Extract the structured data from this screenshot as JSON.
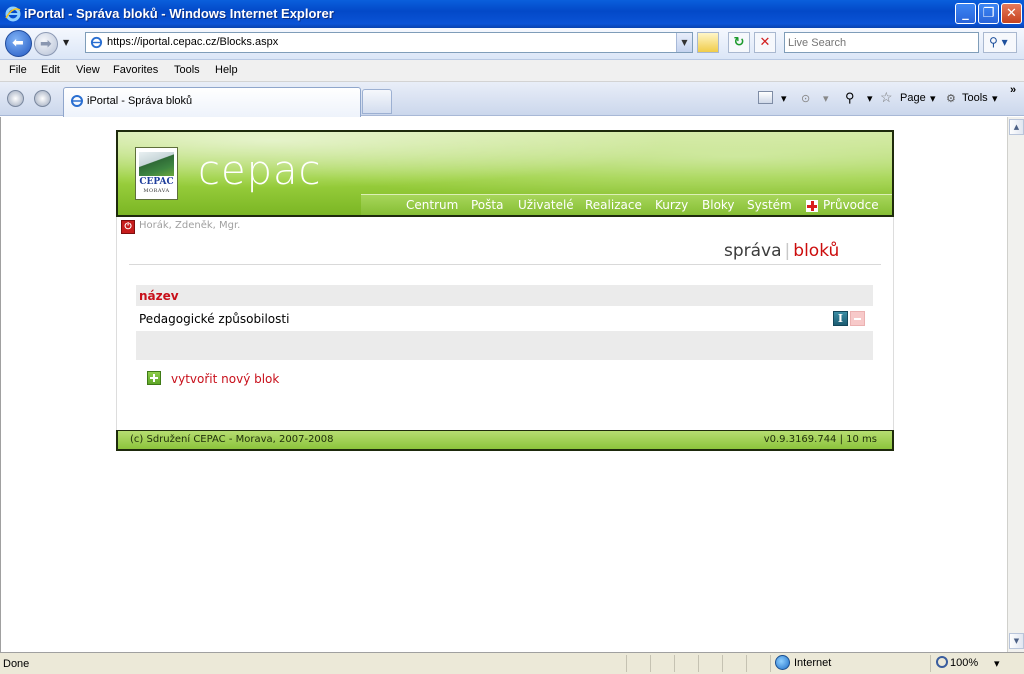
{
  "window": {
    "title": "iPortal - Správa bloků - Windows Internet Explorer"
  },
  "address": {
    "url": "https://iportal.cepac.cz/Blocks.aspx"
  },
  "search": {
    "placeholder": "Live Search"
  },
  "menu": {
    "items": [
      "File",
      "Edit",
      "View",
      "Favorites",
      "Tools",
      "Help"
    ]
  },
  "tabs": {
    "active_label": "iPortal - Správa bloků"
  },
  "commandbar": {
    "page_label": "Page",
    "tools_label": "Tools"
  },
  "site": {
    "logo_name": "CEPAC",
    "logo_sub": "MORAVA",
    "brand": "cepac",
    "nav": [
      "Centrum",
      "Pošta",
      "Uživatelé",
      "Realizace",
      "Kurzy",
      "Bloky",
      "Systém",
      "Průvodce"
    ],
    "user": "Horák, Zdeněk, Mgr.",
    "heading_part1": "správa",
    "heading_sep": "|",
    "heading_part2": "bloků",
    "table_header": "název",
    "rows": [
      {
        "name": "Pedagogické způsobilosti"
      }
    ],
    "add_link": "vytvořit nový blok",
    "footer_left": "(c) Sdružení CEPAC - Morava, 2007-2008",
    "footer_right": "v0.9.3169.744 | 10 ms"
  },
  "status": {
    "text": "Done",
    "zone": "Internet",
    "zoom": "100%"
  },
  "colors": {
    "accent_red": "#cc0d0d",
    "brand_green": "#8cc43c",
    "ie_blue": "#0a53d6"
  }
}
